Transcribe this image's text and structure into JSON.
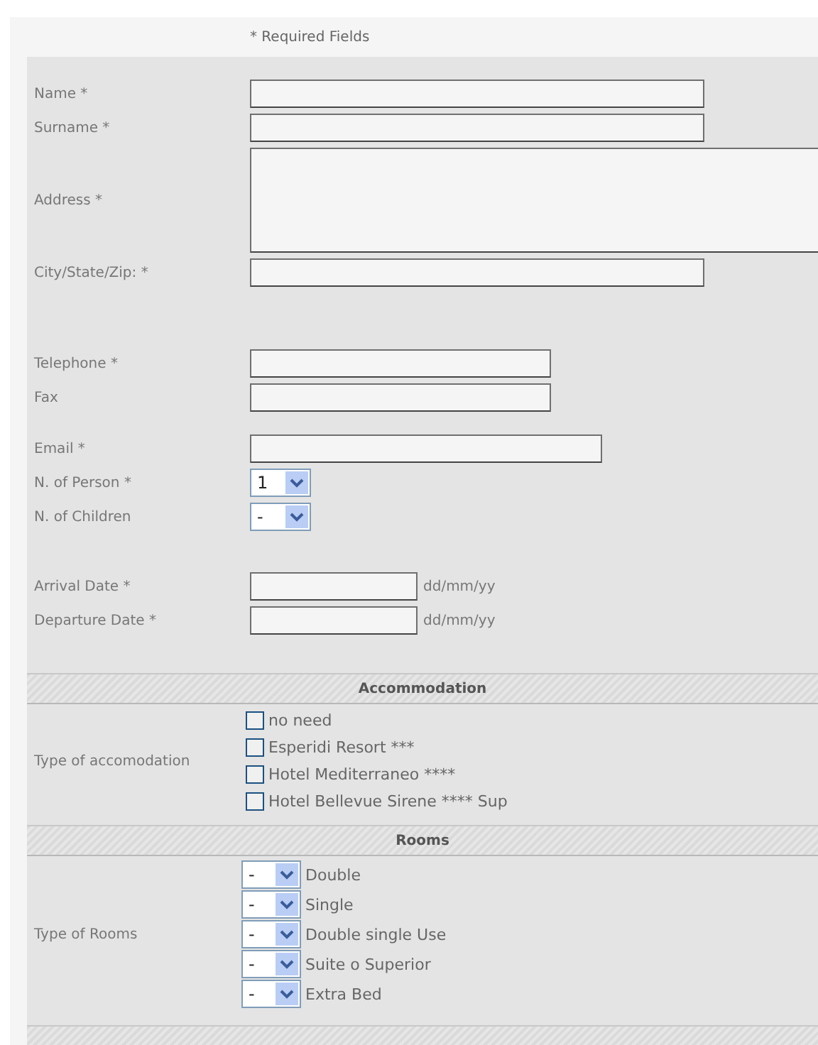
{
  "required_note": "* Required Fields",
  "field_groups": [
    [
      {
        "kind": "text",
        "label": "Name *"
      },
      {
        "kind": "text",
        "label": "Surname *"
      },
      {
        "kind": "textarea",
        "label": "Address *"
      },
      {
        "kind": "text",
        "label": "City/State/Zip: *"
      }
    ],
    [
      {
        "kind": "phone",
        "label": "Telephone *"
      },
      {
        "kind": "phone",
        "label": "Fax"
      }
    ],
    [
      {
        "kind": "email",
        "label": "Email *"
      },
      {
        "kind": "select",
        "label": "N. of Person *",
        "value": "1"
      },
      {
        "kind": "select",
        "label": "N. of Children",
        "value": "-"
      }
    ],
    [
      {
        "kind": "date",
        "label": "Arrival Date *",
        "hint": "dd/mm/yy"
      },
      {
        "kind": "date",
        "label": "Departure Date *",
        "hint": "dd/mm/yy"
      }
    ]
  ],
  "accommodation": {
    "title": "Accommodation",
    "label": "Type of accomodation",
    "options": [
      {
        "label": "no need",
        "checked": false
      },
      {
        "label": "Esperidi Resort ***",
        "checked": false
      },
      {
        "label": "Hotel Mediterraneo ****",
        "checked": false
      },
      {
        "label": "Hotel Bellevue Sirene **** Sup",
        "checked": false
      }
    ]
  },
  "rooms": {
    "title": "Rooms",
    "label": "Type of Rooms",
    "options": [
      {
        "label": "Double",
        "value": "-"
      },
      {
        "label": "Single",
        "value": "-"
      },
      {
        "label": "Double single Use",
        "value": "-"
      },
      {
        "label": "Suite o Superior",
        "value": "-"
      },
      {
        "label": "Extra Bed",
        "value": "-"
      }
    ]
  }
}
